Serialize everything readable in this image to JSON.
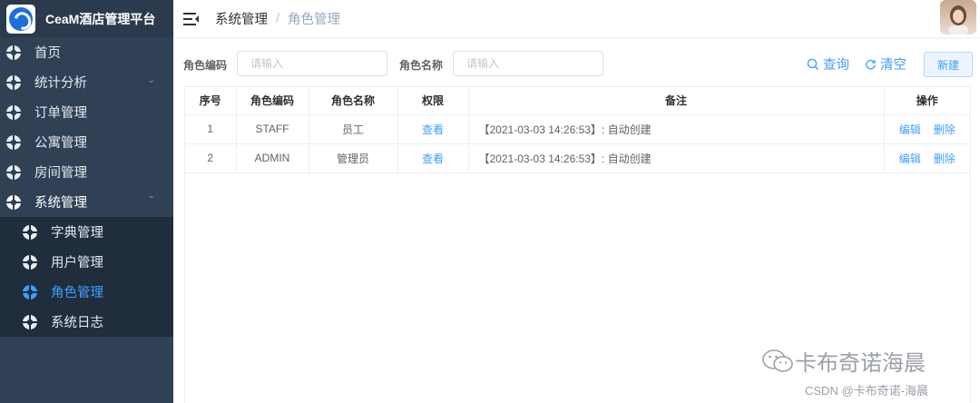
{
  "brand": {
    "title": "CeaM酒店管理平台"
  },
  "sidebar": {
    "items": [
      {
        "label": "首页"
      },
      {
        "label": "统计分析"
      },
      {
        "label": "订单管理"
      },
      {
        "label": "公寓管理"
      },
      {
        "label": "房间管理"
      },
      {
        "label": "系统管理"
      }
    ],
    "submenu": [
      {
        "label": "字典管理"
      },
      {
        "label": "用户管理"
      },
      {
        "label": "角色管理"
      },
      {
        "label": "系统日志"
      }
    ]
  },
  "header": {
    "breadcrumb": [
      "系统管理",
      "角色管理"
    ],
    "separator": "/"
  },
  "search": {
    "code_label": "角色编码",
    "code_placeholder": "请输入",
    "name_label": "角色名称",
    "name_placeholder": "请输入",
    "query_label": "查询",
    "clear_label": "清空",
    "new_label": "新建"
  },
  "table": {
    "columns": [
      "序号",
      "角色编码",
      "角色名称",
      "权限",
      "备注",
      "操作"
    ],
    "rows": [
      {
        "index": "1",
        "code": "STAFF",
        "name": "员工",
        "perm": "查看",
        "note": "【2021-03-03 14:26:53】: 自动创建",
        "edit": "编辑",
        "delete": "删除"
      },
      {
        "index": "2",
        "code": "ADMIN",
        "name": "管理员",
        "perm": "查看",
        "note": "【2021-03-03 14:26:53】: 自动创建",
        "edit": "编辑",
        "delete": "删除"
      }
    ]
  },
  "watermark": {
    "main": "卡布奇诺海晨",
    "sub": "CSDN @卡布奇诺-海晨"
  },
  "colors": {
    "sidebar_bg": "#304156",
    "submenu_bg": "#1f2d3d",
    "accent": "#409eff"
  }
}
